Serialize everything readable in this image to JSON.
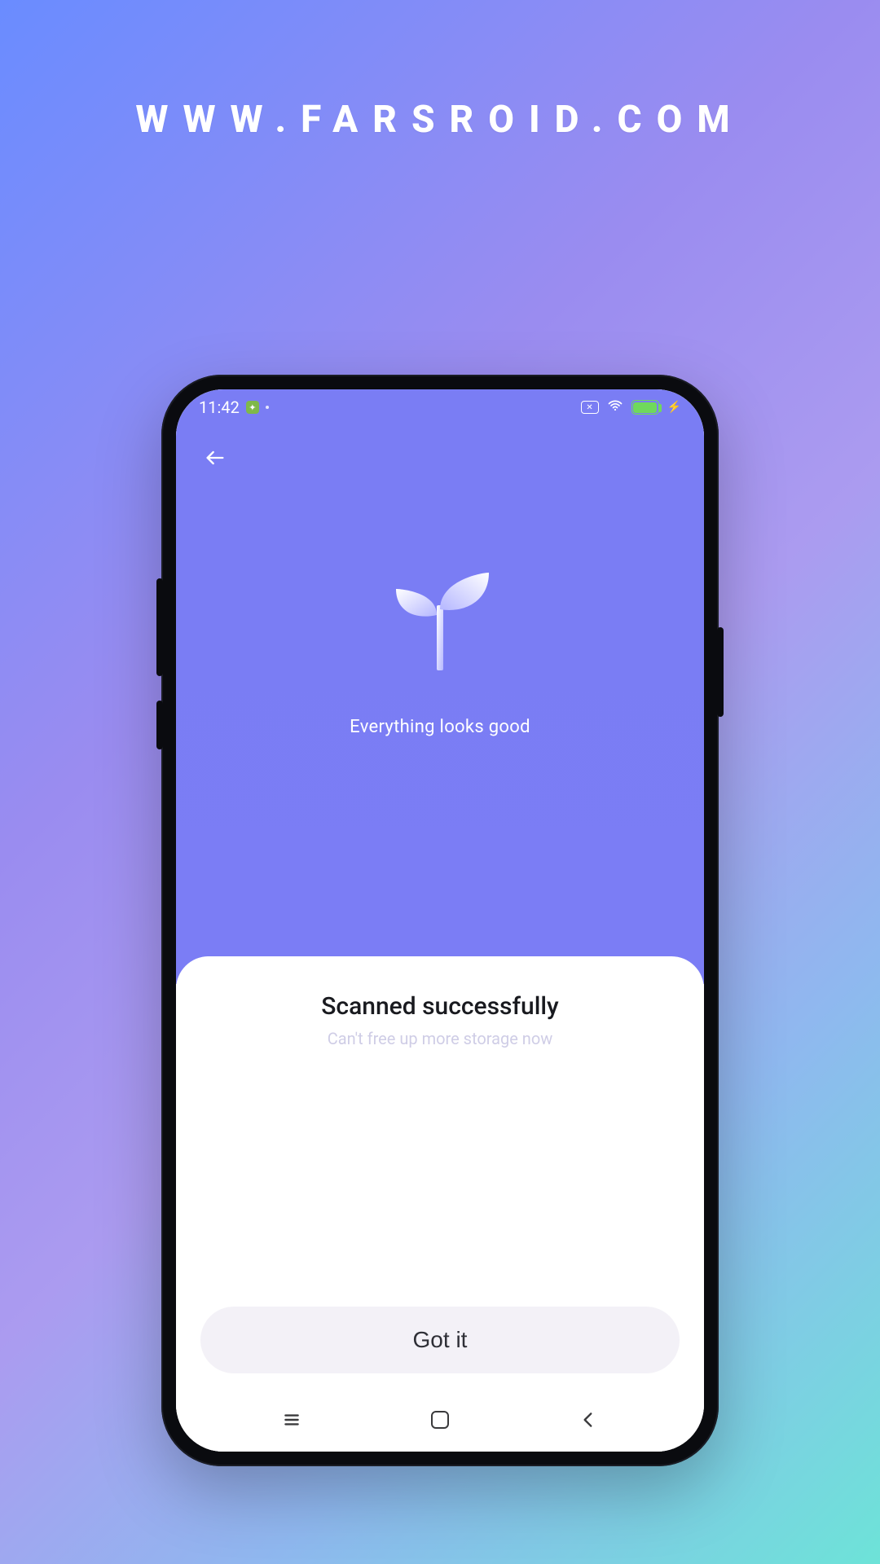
{
  "watermark": "WWW.FARSROID.COM",
  "status": {
    "time": "11:42",
    "rotation_lock_glyph": "✕",
    "status_badge_glyph": "✦"
  },
  "hero": {
    "message": "Everything looks good"
  },
  "sheet": {
    "title": "Scanned successfully",
    "subtitle": "Can't free up more storage now"
  },
  "cta": {
    "label": "Got it"
  },
  "icons": {
    "back": "back-arrow-icon",
    "sprout": "sprout-icon",
    "menu": "menu-icon",
    "home": "home-square-icon",
    "navback": "chevron-left-icon",
    "wifi": "wifi-icon",
    "battery": "battery-icon",
    "bolt": "charging-icon",
    "rotation": "rotation-lock-icon"
  }
}
